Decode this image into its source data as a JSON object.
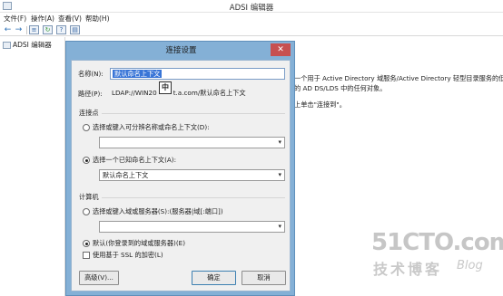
{
  "window": {
    "title": "ADSI 编辑器"
  },
  "menu": [
    "文件(F)",
    "操作(A)",
    "查看(V)",
    "帮助(H)"
  ],
  "toolbar": {
    "icons": [
      "back-arrow-icon",
      "forward-arrow-icon",
      "console-tree-icon",
      "refresh-icon",
      "help-icon",
      "properties-icon"
    ]
  },
  "tree": {
    "root_label": "ADSI 编辑器"
  },
  "description": {
    "line1": "一个用于 Active Directory 域服务/Active Directory 轻型目录服务的低级别",
    "line2": "的 AD DS/LDS 中的任何对象。",
    "line3": "上单击\"连接到\"。"
  },
  "dialog": {
    "title": "连接设置",
    "close": "✕",
    "name_label": "名称(N):",
    "name_value": "默认命名上下文",
    "path_label": "路径(P):",
    "path_value": "LDAP://WIN20",
    "path_value_tail": "t.a.com/默认命名上下文",
    "ime_indicator": "中",
    "connection_point": {
      "title": "连接点",
      "option1": "选择或键入可分辨名称或命名上下文(D):",
      "option1_value": "",
      "option2": "选择一个已知命名上下文(A):",
      "option2_value": "默认命名上下文",
      "selected": "option2"
    },
    "computer": {
      "title": "计算机",
      "option1": "选择或键入域或服务器(S):(服务器|域[:端口])",
      "option1_value": "",
      "option2": "默认(你登录到的域或服务器)(E)",
      "ssl_label": "使用基于 SSL 的加密(L)",
      "ssl_checked": false,
      "selected": "option2"
    },
    "buttons": {
      "advanced": "高级(V)...",
      "ok": "确定",
      "cancel": "取消"
    }
  },
  "watermark": {
    "logo": "51CTO.com",
    "sub": "技术博客",
    "blog": "Blog"
  }
}
